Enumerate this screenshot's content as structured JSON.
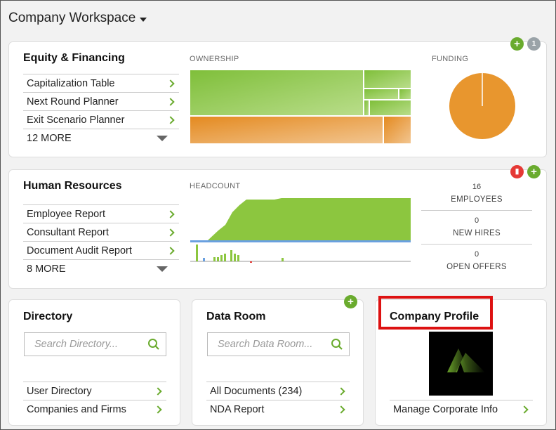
{
  "header": {
    "title": "Company Workspace"
  },
  "equity": {
    "title": "Equity & Financing",
    "links": [
      {
        "label": "Capitalization Table"
      },
      {
        "label": "Next Round Planner"
      },
      {
        "label": "Exit Scenario Planner"
      }
    ],
    "more_label": "12 MORE",
    "ownership_label": "OWNERSHIP",
    "funding_label": "FUNDING",
    "badge_count": "1",
    "colors": {
      "green": "#8cc63f",
      "orange": "#e8962e"
    }
  },
  "hr": {
    "title": "Human Resources",
    "links": [
      {
        "label": "Employee Report"
      },
      {
        "label": "Consultant Report"
      },
      {
        "label": "Document Audit Report"
      }
    ],
    "more_label": "8 MORE",
    "headcount_label": "HEADCOUNT",
    "stats": [
      {
        "value": "16",
        "label": "EMPLOYEES"
      },
      {
        "value": "0",
        "label": "NEW HIRES"
      },
      {
        "value": "0",
        "label": "OPEN OFFERS"
      }
    ]
  },
  "directory": {
    "title": "Directory",
    "search_placeholder": "Search Directory...",
    "links": [
      {
        "label": "User Directory"
      },
      {
        "label": "Companies and Firms"
      }
    ]
  },
  "dataroom": {
    "title": "Data Room",
    "search_placeholder": "Search Data Room...",
    "links": [
      {
        "label": "All Documents (234)"
      },
      {
        "label": "NDA Report"
      }
    ]
  },
  "profile": {
    "title": "Company Profile",
    "link_label": "Manage Corporate Info"
  }
}
